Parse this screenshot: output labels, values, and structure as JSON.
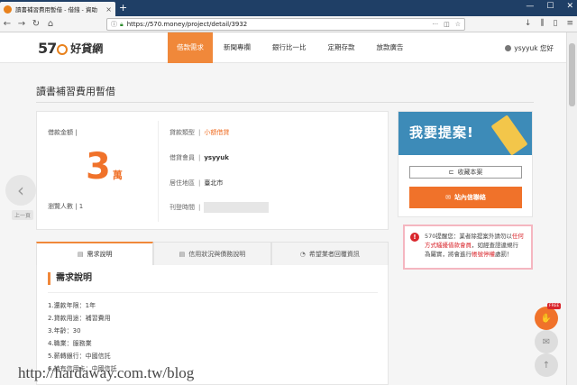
{
  "browser": {
    "tab_title": "讀書補習費用暫借 - 借錢 - 資助",
    "tab_close": "×",
    "new_tab": "+",
    "window_controls": {
      "minimize": "—",
      "maximize": "☐",
      "close": "✕"
    },
    "url": "https://570.money/project/detail/3932",
    "icons": [
      "back-icon",
      "forward-icon",
      "reload-icon",
      "home-icon",
      "info-icon",
      "lock-icon",
      "ellipsis-icon",
      "pocket-icon",
      "star-icon",
      "download-icon",
      "library-icon",
      "sidebar-icon",
      "menu-icon"
    ]
  },
  "site": {
    "logo_number": "57",
    "logo_text": "好貸網",
    "nav": [
      {
        "label": "借款需求",
        "active": true
      },
      {
        "label": "新聞專欄",
        "active": false
      },
      {
        "label": "銀行比一比",
        "active": false
      },
      {
        "label": "定期存款",
        "active": false
      },
      {
        "label": "放款廣告",
        "active": false
      }
    ],
    "user": "ysyyuk 您好"
  },
  "page": {
    "title": "讀書補習費用暫借",
    "amount_label": "借款金額 |",
    "amount_value": "3",
    "amount_unit": "萬",
    "views_label": "瀏覽人數 | 1",
    "fields": [
      {
        "label": "貸款類型",
        "value": "小額借貸"
      },
      {
        "label": "借貸會員",
        "value": "ysyyuk"
      },
      {
        "label": "居住地區",
        "value": "臺北市"
      },
      {
        "label": "刊登時間",
        "value": ""
      }
    ],
    "tabs": [
      {
        "label": "需求說明",
        "icon": "document-icon",
        "active": true
      },
      {
        "label": "信用狀況與債務說明",
        "icon": "document-icon",
        "active": false
      },
      {
        "label": "希望業者回覆資訊",
        "icon": "chat-icon",
        "active": false
      }
    ],
    "section_title": "需求說明",
    "requirements": [
      "1.還款年限：1年",
      "2.貸款用途：補習費用",
      "3.年齡：30",
      "4.職業：服務業",
      "5.薪轉銀行：中國信託",
      "6.持有信用卡：中國信託"
    ]
  },
  "side": {
    "banner_text": "我要提案!",
    "save_button": "收藏本案",
    "contact_button": "站內信聯絡",
    "warning_prefix": "570提醒您：業者除提案外請勿以",
    "warning_red1": "任何方式騷擾借款會員",
    "warning_mid": "，如經查證違規行為屬實，將會進行",
    "warning_red2": "帳號停權",
    "warning_suffix": "處罰！"
  },
  "floating": {
    "free_badge": "FREE"
  },
  "nav_prev": {
    "arrow": "‹",
    "label": "上一頁"
  },
  "watermark": "http://hardaway.com.tw/blog",
  "colors": {
    "accent": "#f0722a",
    "browser_frame": "#1f3f66",
    "banner": "#3d8bb8",
    "warning_border": "#f5b6c0",
    "warning_red": "#d9262c"
  }
}
